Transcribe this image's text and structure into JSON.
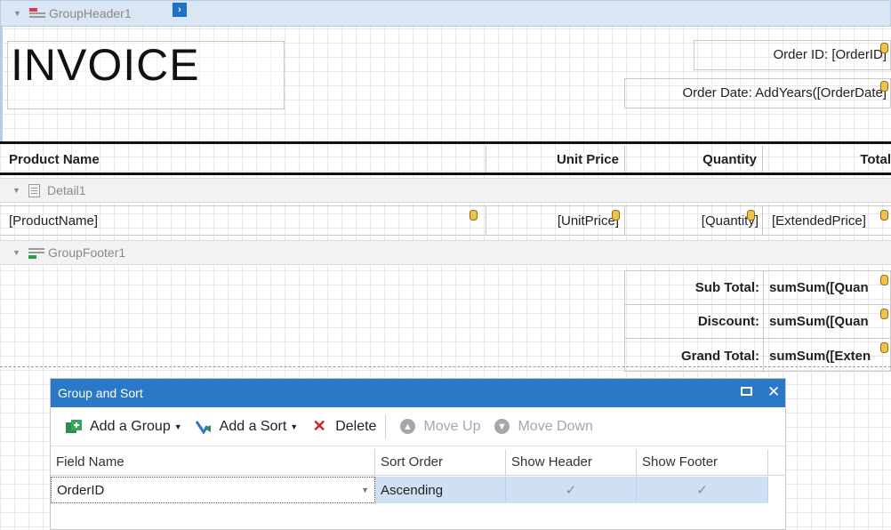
{
  "bands": {
    "group_header": "GroupHeader1",
    "detail": "Detail1",
    "group_footer": "GroupFooter1"
  },
  "header": {
    "title": "INVOICE",
    "order_id": "Order ID: [OrderID]",
    "order_date": "Order Date: AddYears([OrderDate]"
  },
  "columns": {
    "product_name": "Product Name",
    "unit_price": "Unit Price",
    "quantity": "Quantity",
    "total": "Total"
  },
  "detail_fields": {
    "product_name": "[ProductName]",
    "unit_price": "[UnitPrice]",
    "quantity": "[Quantity]",
    "extended_price": "[ExtendedPrice]"
  },
  "totals": {
    "sub_total_label": "Sub Total:",
    "sub_total_value": "sumSum([Quan",
    "discount_label": "Discount:",
    "discount_value": "sumSum([Quan",
    "grand_total_label": "Grand Total:",
    "grand_total_value": "sumSum([Exten"
  },
  "panel": {
    "title": "Group and Sort",
    "toolbar": {
      "add_group": "Add a Group",
      "add_sort": "Add a Sort",
      "delete": "Delete",
      "move_up": "Move Up",
      "move_down": "Move Down"
    },
    "grid_headers": {
      "field_name": "Field Name",
      "sort_order": "Sort Order",
      "show_header": "Show Header",
      "show_footer": "Show Footer"
    },
    "row": {
      "field_name": "OrderID",
      "sort_order": "Ascending",
      "show_header": "✓",
      "show_footer": "✓"
    }
  },
  "colors": {
    "accent": "#2b78c6",
    "group_header_band": "#dae6f4",
    "selected_row": "#cfe0f4"
  },
  "icons": [
    "expand-arrow-icon",
    "group-header-band-icon",
    "detail-band-icon",
    "group-footer-band-icon",
    "database-field-icon",
    "maximize-icon",
    "close-icon",
    "add-group-icon",
    "add-sort-icon",
    "delete-icon",
    "move-up-icon",
    "move-down-icon",
    "dropdown-arrow-icon",
    "checkmark-icon"
  ]
}
